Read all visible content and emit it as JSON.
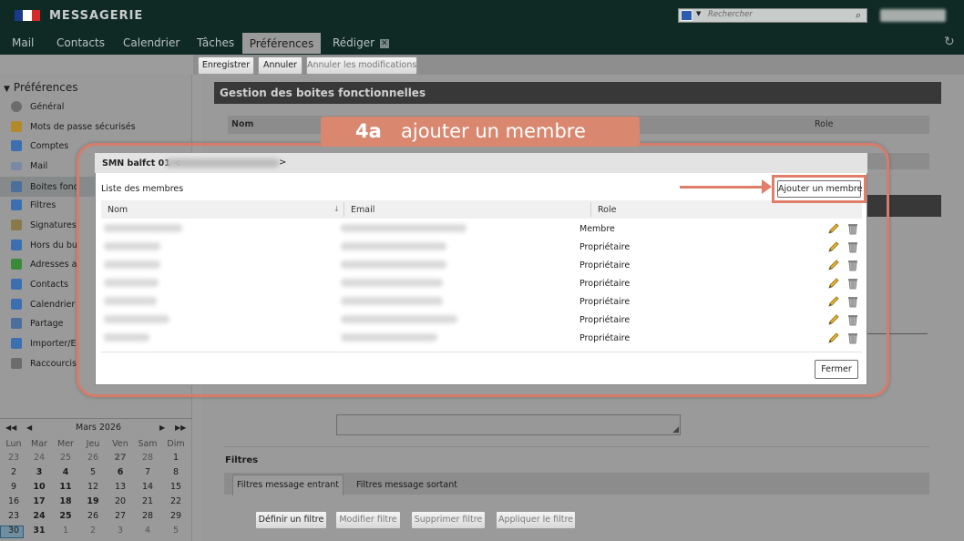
{
  "header": {
    "app_title": "MESSAGERIE",
    "search_placeholder": "Rechercher",
    "tabs": [
      {
        "label": "Mail"
      },
      {
        "label": "Contacts"
      },
      {
        "label": "Calendrier"
      },
      {
        "label": "Tâches"
      },
      {
        "label": "Préférences",
        "active": true
      },
      {
        "label": "Rédiger"
      }
    ]
  },
  "toolbar": {
    "save_label": "Enregistrer",
    "cancel_label": "Annuler",
    "cancel_changes_label": "Annuler les modifications"
  },
  "sidebar": {
    "heading": "Préférences",
    "items": [
      {
        "label": "Général",
        "icon": "gear-icon"
      },
      {
        "label": "Mots de passe sécurisés",
        "icon": "keys-icon"
      },
      {
        "label": "Comptes",
        "icon": "users-icon"
      },
      {
        "label": "Mail",
        "icon": "mail-icon"
      },
      {
        "label": "Boites fonc",
        "icon": "shared-mailbox-icon",
        "selected": true
      },
      {
        "label": "Filtres",
        "icon": "filter-icon"
      },
      {
        "label": "Signatures",
        "icon": "signature-icon"
      },
      {
        "label": "Hors du bu",
        "icon": "out-of-office-icon"
      },
      {
        "label": "Adresses a",
        "icon": "shield-icon"
      },
      {
        "label": "Contacts",
        "icon": "contacts-icon"
      },
      {
        "label": "Calendrier",
        "icon": "calendar-icon"
      },
      {
        "label": "Partage",
        "icon": "share-icon"
      },
      {
        "label": "Importer/E",
        "icon": "import-export-icon"
      },
      {
        "label": "Raccourcis",
        "icon": "shortcuts-icon"
      }
    ]
  },
  "mini_calendar": {
    "month_label": "Mars 2026",
    "day_headers": [
      "Lun",
      "Mar",
      "Mer",
      "Jeu",
      "Ven",
      "Sam",
      "Dim"
    ],
    "weeks": [
      [
        "23",
        "24",
        "25",
        "26",
        "27",
        "28",
        "1"
      ],
      [
        "2",
        "3",
        "4",
        "5",
        "6",
        "7",
        "8"
      ],
      [
        "9",
        "10",
        "11",
        "12",
        "13",
        "14",
        "15"
      ],
      [
        "16",
        "17",
        "18",
        "19",
        "20",
        "21",
        "22"
      ],
      [
        "23",
        "24",
        "25",
        "26",
        "27",
        "28",
        "29"
      ],
      [
        "30",
        "31",
        "1",
        "2",
        "3",
        "4",
        "5"
      ]
    ],
    "today": "30"
  },
  "main": {
    "section_title": "Gestion des boites fonctionnelles",
    "table_head_name": "Nom",
    "table_head_role": "Role",
    "filters_title": "Filtres",
    "filters_tab_in": "Filtres message entrant",
    "filters_tab_out": "Filtres message sortant",
    "filter_buttons": [
      "Définir un filtre",
      "Modifier filtre",
      "Supprimer filtre",
      "Appliquer le filtre"
    ]
  },
  "modal": {
    "title_prefix": "SMN balfct 01 <",
    "title_suffix": ">",
    "members_label": "Liste des membres",
    "add_member_label": "Ajouter un membre",
    "columns": {
      "name": "Nom",
      "email": "Email",
      "role": "Role"
    },
    "members": [
      {
        "role": "Membre"
      },
      {
        "role": "Propriétaire"
      },
      {
        "role": "Propriétaire"
      },
      {
        "role": "Propriétaire"
      },
      {
        "role": "Propriétaire"
      },
      {
        "role": "Propriétaire"
      },
      {
        "role": "Propriétaire"
      }
    ],
    "close_label": "Fermer"
  },
  "callout": {
    "step_number": "4a",
    "step_text": "ajouter un membre",
    "color": "#d9876f"
  }
}
